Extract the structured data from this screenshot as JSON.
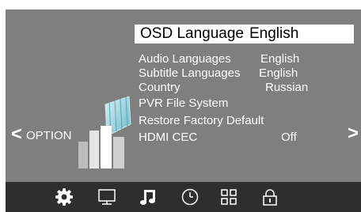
{
  "nav": {
    "prev_arrow": "<",
    "prev_label": "OPTION",
    "next_arrow": ">"
  },
  "menu": {
    "selected": {
      "label": "OSD Language",
      "value": "English"
    },
    "items": [
      {
        "label": "Audio Languages",
        "value": "English"
      },
      {
        "label": "Subtitle Languages",
        "value": "English"
      },
      {
        "label": "Country",
        "value": "Russian"
      },
      {
        "label": "PVR File System",
        "value": ""
      },
      {
        "label": "Restore Factory Default",
        "value": ""
      },
      {
        "label": "HDMI CEC",
        "value": "Off"
      }
    ]
  },
  "tabs": [
    {
      "icon": "gear-icon",
      "active": true
    },
    {
      "icon": "monitor-icon",
      "active": false
    },
    {
      "icon": "music-note-icon",
      "active": false
    },
    {
      "icon": "clock-icon",
      "active": false
    },
    {
      "icon": "grid-icon",
      "active": false
    },
    {
      "icon": "lock-icon",
      "active": false
    }
  ],
  "colors": {
    "background": "#7f7f7f",
    "bottom_bar": "#2e2e2e",
    "highlight": "#ffffff",
    "text": "#ffffff"
  }
}
